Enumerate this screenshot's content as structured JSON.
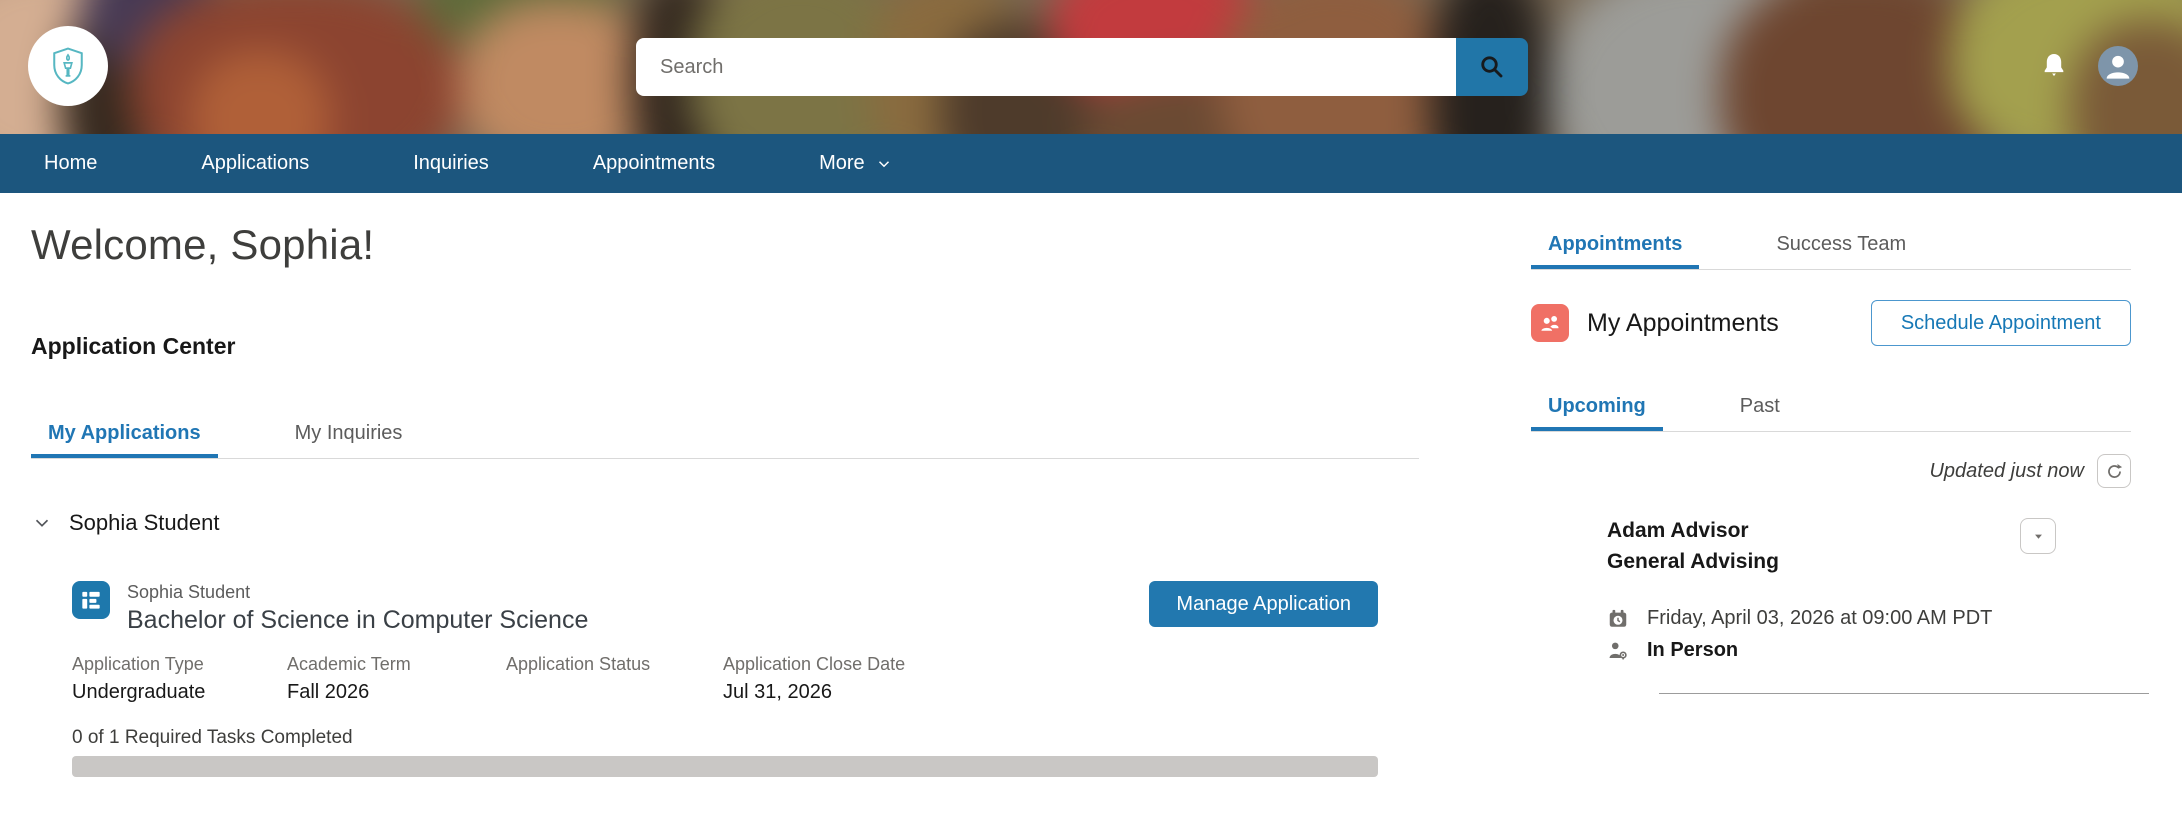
{
  "header": {
    "search_placeholder": "Search"
  },
  "nav": {
    "items": [
      "Home",
      "Applications",
      "Inquiries",
      "Appointments"
    ],
    "more_label": "More"
  },
  "main": {
    "welcome_title": "Welcome, Sophia!",
    "section_title": "Application Center",
    "tabs": [
      {
        "label": "My Applications",
        "active": true
      },
      {
        "label": "My Inquiries",
        "active": false
      }
    ],
    "group_header": "Sophia Student",
    "application": {
      "applicant": "Sophia Student",
      "program": "Bachelor of Science in Computer Science",
      "manage_button": "Manage Application",
      "fields": [
        {
          "label": "Application Type",
          "value": "Undergraduate"
        },
        {
          "label": "Academic Term",
          "value": "Fall 2026"
        },
        {
          "label": "Application Status",
          "value": ""
        },
        {
          "label": "Application Close Date",
          "value": "Jul 31, 2026"
        }
      ],
      "tasks_text": "0 of 1 Required Tasks Completed",
      "progress_percent": 0
    }
  },
  "sidebar": {
    "tabs": [
      {
        "label": "Appointments",
        "active": true
      },
      {
        "label": "Success Team",
        "active": false
      }
    ],
    "my_appointments_title": "My Appointments",
    "schedule_button": "Schedule Appointment",
    "sub_tabs": [
      {
        "label": "Upcoming",
        "active": true
      },
      {
        "label": "Past",
        "active": false
      }
    ],
    "updated_text": "Updated just now",
    "appointment": {
      "advisor": "Adam Advisor",
      "type": "General Advising",
      "datetime": "Friday, April 03, 2026 at 09:00 AM PDT",
      "mode": "In Person"
    }
  },
  "colors": {
    "nav_bar_blue": "#1C567E",
    "accent_tab_blue": "#2076B4",
    "button_blue": "#2278AF",
    "app_icon_blue": "#1E78AC",
    "appointments_icon_coral": "#F07065",
    "progress_track_gray": "#C9C7C5",
    "logo_teal": "#56B7C2"
  }
}
